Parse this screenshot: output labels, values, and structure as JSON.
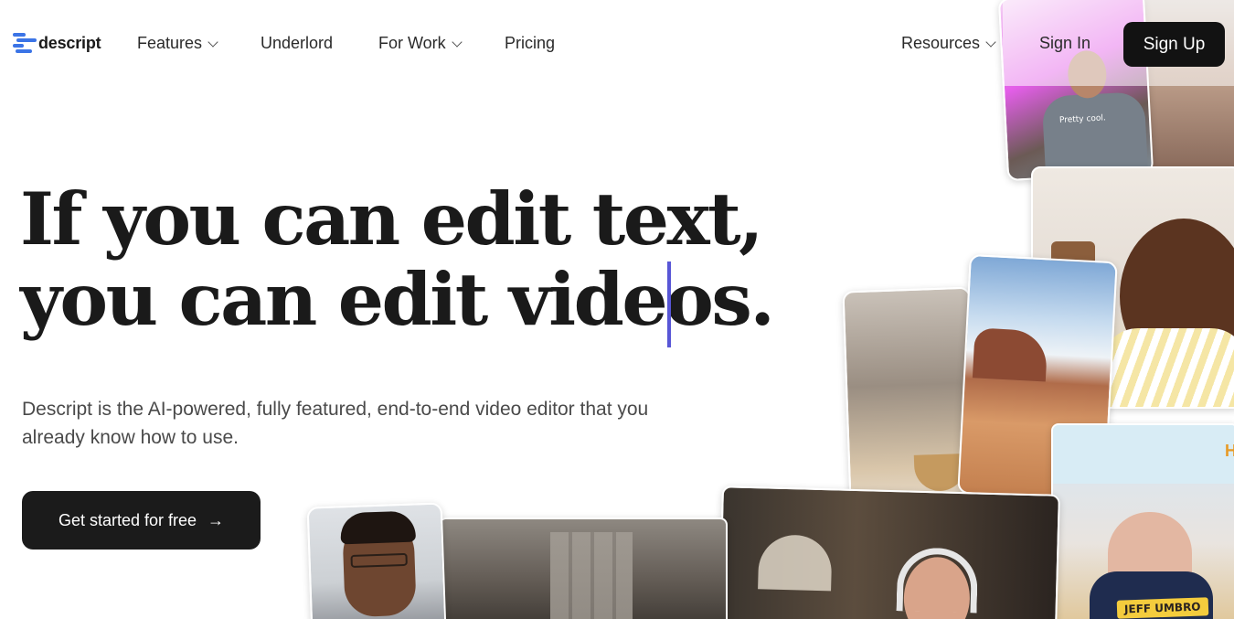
{
  "brand": {
    "name": "descript",
    "accent": "#3b74e6"
  },
  "nav": {
    "items": [
      {
        "label": "Features",
        "has_dropdown": true
      },
      {
        "label": "Underlord",
        "has_dropdown": false
      },
      {
        "label": "For Work",
        "has_dropdown": true
      },
      {
        "label": "Pricing",
        "has_dropdown": false
      },
      {
        "label": "Resources",
        "has_dropdown": true
      }
    ],
    "sign_in": "Sign In",
    "sign_up": "Sign Up"
  },
  "hero": {
    "headline_line1": "If you can edit text,",
    "headline_line2": "you can edit videos.",
    "caret_color": "#5856d6",
    "subheadline": "Descript is the AI-powered, fully featured, end-to-end video editor that you already know how to use.",
    "cta_label": "Get started for free",
    "cta_icon": "arrow-right-icon"
  },
  "collage": {
    "shirt_text": "Pretty cool.",
    "name_tag": "JEFF UMBRO",
    "podcast_logo": "H"
  }
}
